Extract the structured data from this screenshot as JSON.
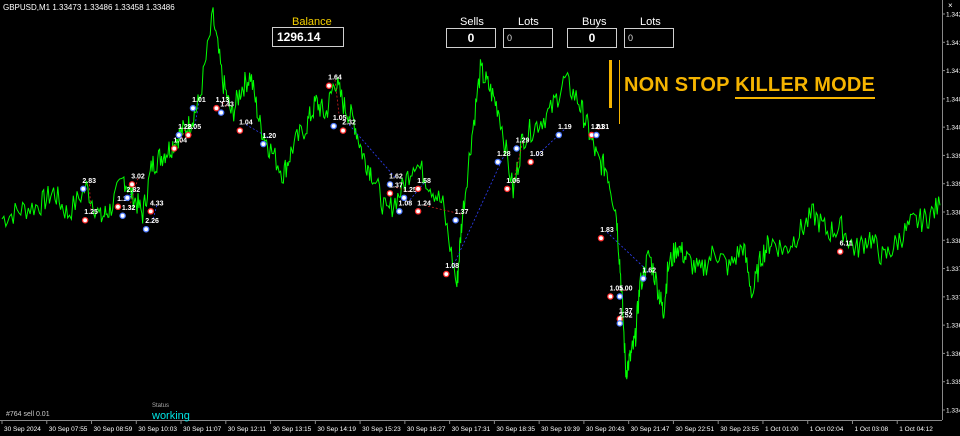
{
  "symbol_info": "GBPUSD,M1  1.33473 1.33486 1.33458 1.33486",
  "close_mark": "×",
  "panel": {
    "balance_label": "Balance",
    "balance_value": "1296.14",
    "sells_label": "Sells",
    "sells_value": "0",
    "sells_lots_label": "Lots",
    "sells_lots_value": "0",
    "buys_label": "Buys",
    "buys_value": "0",
    "buys_lots_label": "Lots",
    "buys_lots_value": "0"
  },
  "banner": {
    "part1": "NON STOP ",
    "part2": "KILLER MODE"
  },
  "status": {
    "label": "Status",
    "value": "working"
  },
  "order_note": "#764 sell 0.01",
  "colors": {
    "price": "#00ff00",
    "banner": "#f5b400",
    "status": "#00e5e5",
    "buy_marker": "#4f7cff",
    "sell_marker": "#ff3030"
  },
  "chart_data": {
    "type": "line",
    "symbol": "GBPUSD",
    "timeframe": "M1",
    "ylim": [
      1.3335,
      1.3426
    ],
    "y_ticks": [
      "1.342",
      "1.341",
      "1.341",
      "1.340",
      "1.340",
      "1.339",
      "1.339",
      "1.338",
      "1.338",
      "1.337",
      "1.337",
      "1.336",
      "1.336",
      "1.335",
      "1.334"
    ],
    "x_ticks": [
      "30 Sep 2024",
      "30 Sep 07:55",
      "30 Sep 08:59",
      "30 Sep 10:03",
      "30 Sep 11:07",
      "30 Sep 12:11",
      "30 Sep 13:15",
      "30 Sep 14:19",
      "30 Sep 15:23",
      "30 Sep 16:27",
      "30 Sep 17:31",
      "30 Sep 18:35",
      "30 Sep 19:39",
      "30 Sep 20:43",
      "30 Sep 21:47",
      "30 Sep 22:51",
      "30 Sep 23:55",
      "1 Oct 01:00",
      "1 Oct 02:04",
      "1 Oct 03:08",
      "1 Oct 04:12"
    ],
    "price_path": [
      [
        0,
        1.3379
      ],
      [
        0.02,
        1.3381
      ],
      [
        0.04,
        1.3382
      ],
      [
        0.055,
        1.3385
      ],
      [
        0.07,
        1.338
      ],
      [
        0.09,
        1.3386
      ],
      [
        0.105,
        1.3379
      ],
      [
        0.115,
        1.3381
      ],
      [
        0.13,
        1.3388
      ],
      [
        0.14,
        1.3384
      ],
      [
        0.15,
        1.338
      ],
      [
        0.16,
        1.3391
      ],
      [
        0.17,
        1.3393
      ],
      [
        0.18,
        1.3395
      ],
      [
        0.19,
        1.3398
      ],
      [
        0.2,
        1.34
      ],
      [
        0.21,
        1.3405
      ],
      [
        0.225,
        1.3424
      ],
      [
        0.235,
        1.341
      ],
      [
        0.245,
        1.3402
      ],
      [
        0.255,
        1.3408
      ],
      [
        0.265,
        1.3411
      ],
      [
        0.275,
        1.34
      ],
      [
        0.285,
        1.3395
      ],
      [
        0.3,
        1.3389
      ],
      [
        0.31,
        1.3395
      ],
      [
        0.325,
        1.34
      ],
      [
        0.335,
        1.3405
      ],
      [
        0.345,
        1.3402
      ],
      [
        0.355,
        1.341
      ],
      [
        0.365,
        1.3404
      ],
      [
        0.375,
        1.3401
      ],
      [
        0.385,
        1.3393
      ],
      [
        0.395,
        1.3389
      ],
      [
        0.41,
        1.338
      ],
      [
        0.425,
        1.3385
      ],
      [
        0.44,
        1.3392
      ],
      [
        0.455,
        1.3387
      ],
      [
        0.47,
        1.3382
      ],
      [
        0.485,
        1.3364
      ],
      [
        0.49,
        1.3378
      ],
      [
        0.5,
        1.3396
      ],
      [
        0.51,
        1.3412
      ],
      [
        0.52,
        1.3408
      ],
      [
        0.53,
        1.3403
      ],
      [
        0.545,
        1.3385
      ],
      [
        0.555,
        1.3397
      ],
      [
        0.57,
        1.34
      ],
      [
        0.585,
        1.3403
      ],
      [
        0.6,
        1.341
      ],
      [
        0.615,
        1.3405
      ],
      [
        0.625,
        1.3399
      ],
      [
        0.635,
        1.3392
      ],
      [
        0.645,
        1.339
      ],
      [
        0.655,
        1.338
      ],
      [
        0.66,
        1.3365
      ],
      [
        0.665,
        1.3345
      ],
      [
        0.67,
        1.3348
      ],
      [
        0.675,
        1.3352
      ],
      [
        0.68,
        1.3364
      ],
      [
        0.69,
        1.3371
      ],
      [
        0.7,
        1.3363
      ],
      [
        0.705,
        1.3358
      ],
      [
        0.71,
        1.3368
      ],
      [
        0.72,
        1.3373
      ],
      [
        0.73,
        1.337
      ],
      [
        0.745,
        1.3367
      ],
      [
        0.76,
        1.3372
      ],
      [
        0.775,
        1.3368
      ],
      [
        0.79,
        1.3373
      ],
      [
        0.8,
        1.3362
      ],
      [
        0.81,
        1.3371
      ],
      [
        0.82,
        1.3374
      ],
      [
        0.835,
        1.3372
      ],
      [
        0.85,
        1.3376
      ],
      [
        0.865,
        1.338
      ],
      [
        0.88,
        1.3376
      ],
      [
        0.895,
        1.3377
      ],
      [
        0.91,
        1.3372
      ],
      [
        0.925,
        1.3375
      ],
      [
        0.94,
        1.337
      ],
      [
        0.955,
        1.3374
      ],
      [
        0.97,
        1.3378
      ],
      [
        0.985,
        1.3379
      ],
      [
        1.0,
        1.3382
      ]
    ],
    "annotations": [
      {
        "t": 0.095,
        "v": 1.338,
        "text": "1.25"
      },
      {
        "t": 0.093,
        "v": 1.3387,
        "text": "2.83"
      },
      {
        "t": 0.13,
        "v": 1.3383,
        "text": "1.17"
      },
      {
        "t": 0.14,
        "v": 1.3385,
        "text": "2.82"
      },
      {
        "t": 0.145,
        "v": 1.3388,
        "text": "3.02"
      },
      {
        "t": 0.135,
        "v": 1.3381,
        "text": "1.32"
      },
      {
        "t": 0.165,
        "v": 1.3382,
        "text": "4.33"
      },
      {
        "t": 0.16,
        "v": 1.3378,
        "text": "2.26"
      },
      {
        "t": 0.19,
        "v": 1.3396,
        "text": "1.04"
      },
      {
        "t": 0.195,
        "v": 1.3399,
        "text": "1.28"
      },
      {
        "t": 0.205,
        "v": 1.3399,
        "text": "2.05"
      },
      {
        "t": 0.21,
        "v": 1.3405,
        "text": "1.01"
      },
      {
        "t": 0.235,
        "v": 1.3405,
        "text": "1.13"
      },
      {
        "t": 0.24,
        "v": 1.3404,
        "text": "1.43"
      },
      {
        "t": 0.26,
        "v": 1.34,
        "text": "1.04"
      },
      {
        "t": 0.285,
        "v": 1.3397,
        "text": "1.20"
      },
      {
        "t": 0.355,
        "v": 1.341,
        "text": "1.64"
      },
      {
        "t": 0.36,
        "v": 1.3401,
        "text": "1.05"
      },
      {
        "t": 0.37,
        "v": 1.34,
        "text": "2.32"
      },
      {
        "t": 0.42,
        "v": 1.3388,
        "text": "1.62"
      },
      {
        "t": 0.42,
        "v": 1.3386,
        "text": "1.37"
      },
      {
        "t": 0.435,
        "v": 1.3385,
        "text": "1.25"
      },
      {
        "t": 0.45,
        "v": 1.3387,
        "text": "1.58"
      },
      {
        "t": 0.43,
        "v": 1.3382,
        "text": "1.08"
      },
      {
        "t": 0.45,
        "v": 1.3382,
        "text": "1.24"
      },
      {
        "t": 0.49,
        "v": 1.338,
        "text": "1.37"
      },
      {
        "t": 0.48,
        "v": 1.3368,
        "text": "1.08"
      },
      {
        "t": 0.535,
        "v": 1.3393,
        "text": "1.28"
      },
      {
        "t": 0.545,
        "v": 1.3387,
        "text": "1.06"
      },
      {
        "t": 0.555,
        "v": 1.3396,
        "text": "1.29"
      },
      {
        "t": 0.57,
        "v": 1.3393,
        "text": "1.03"
      },
      {
        "t": 0.6,
        "v": 1.3399,
        "text": "1.19"
      },
      {
        "t": 0.635,
        "v": 1.3399,
        "text": "1.01"
      },
      {
        "t": 0.64,
        "v": 1.3399,
        "text": "2.31"
      },
      {
        "t": 0.645,
        "v": 1.3376,
        "text": "1.83"
      },
      {
        "t": 0.69,
        "v": 1.3367,
        "text": "1.62"
      },
      {
        "t": 0.655,
        "v": 1.3363,
        "text": "1.05"
      },
      {
        "t": 0.665,
        "v": 1.3363,
        "text": "1.00"
      },
      {
        "t": 0.665,
        "v": 1.3358,
        "text": "1.37"
      },
      {
        "t": 0.665,
        "v": 1.3357,
        "text": "2.52"
      },
      {
        "t": 0.9,
        "v": 1.3373,
        "text": "6.11"
      }
    ]
  }
}
